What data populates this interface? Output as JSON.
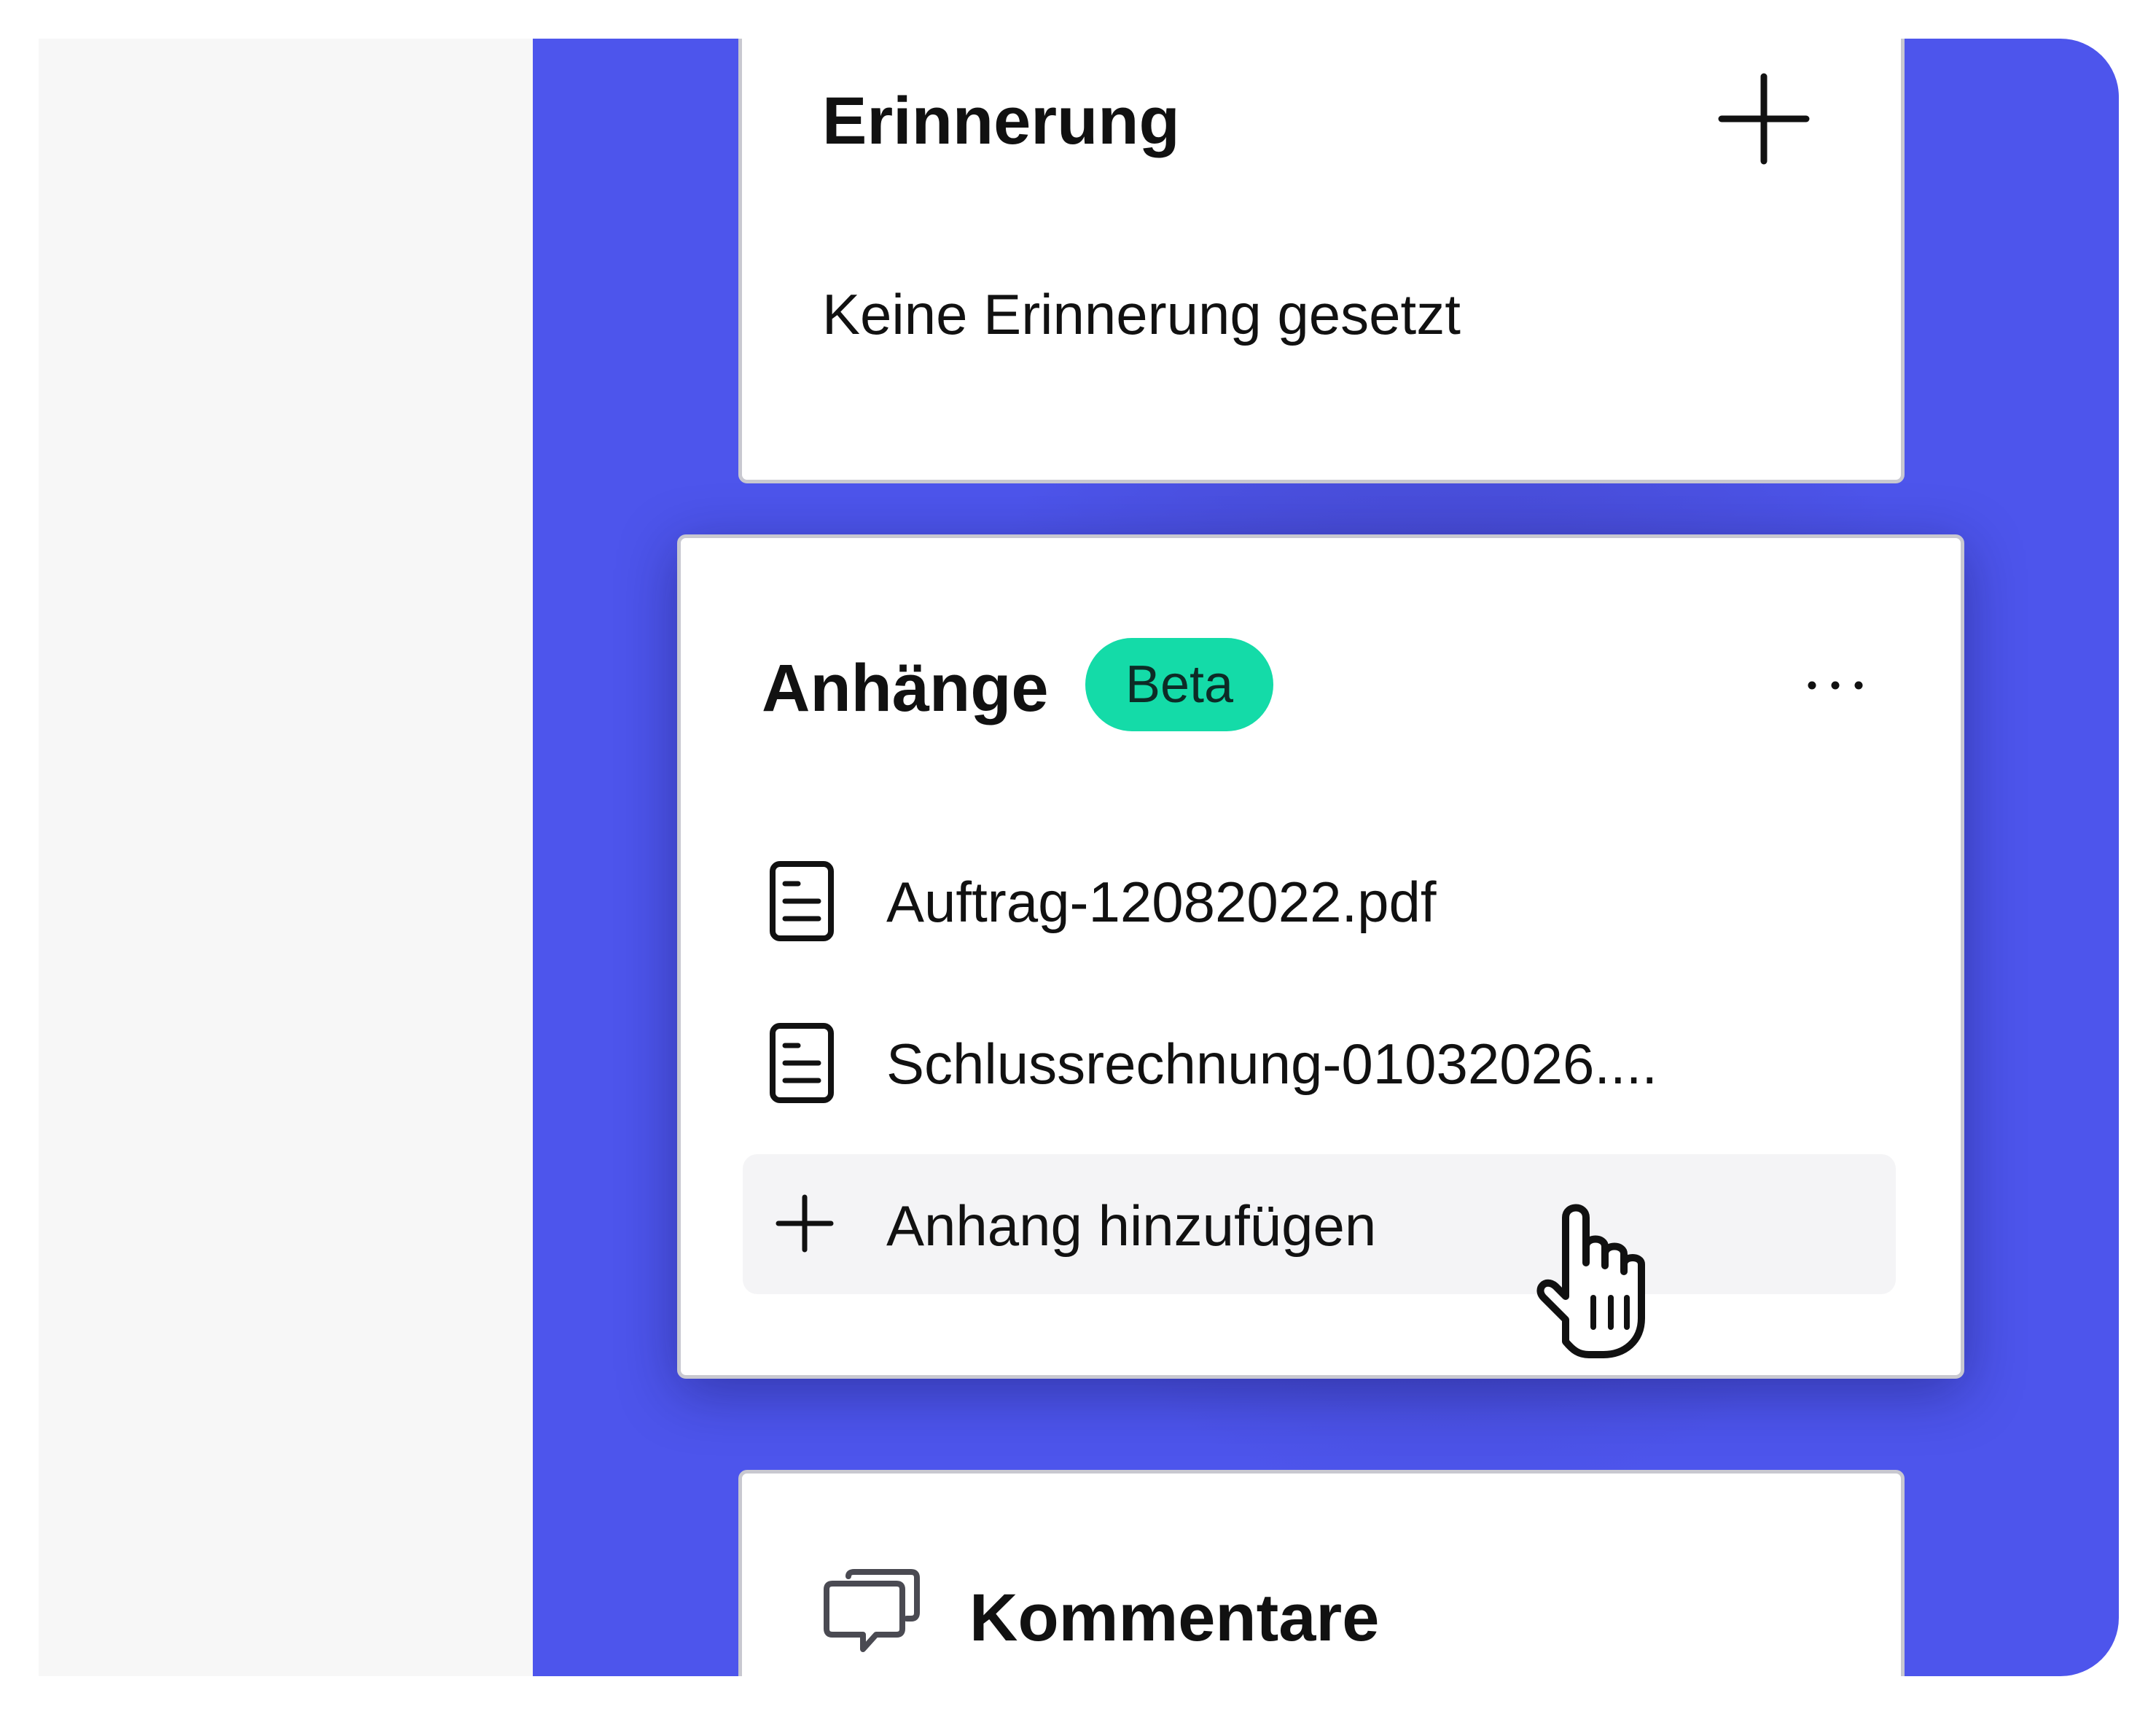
{
  "reminder": {
    "title": "Erinnerung",
    "empty_text": "Keine Erinnerung gesetzt"
  },
  "attachments": {
    "title": "Anhänge",
    "badge": "Beta",
    "files": [
      {
        "name": "Auftrag-12082022.pdf"
      },
      {
        "name": "Schlussrechnung-01032026...."
      }
    ],
    "add_label": "Anhang hinzufügen"
  },
  "comments": {
    "title": "Kommentare"
  },
  "colors": {
    "accent": "#4d55ec",
    "badge": "#14dba8",
    "card_border": "#c8c8d0",
    "side_panel": "#f7f7f7"
  },
  "icons": [
    "plus-icon",
    "more-icon",
    "document-icon",
    "hand-pointer-cursor-icon",
    "comments-icon"
  ]
}
